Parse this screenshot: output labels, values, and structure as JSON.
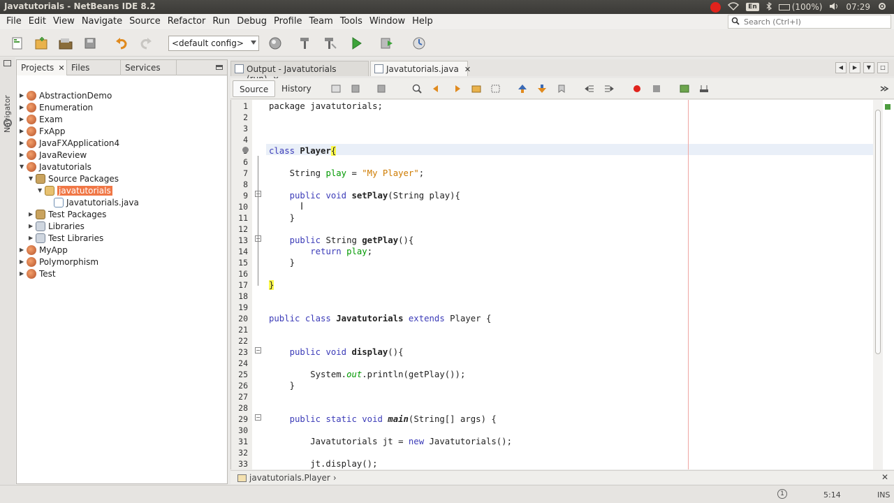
{
  "window": {
    "title": "Javatutorials - NetBeans IDE 8.2"
  },
  "tray": {
    "keyboard": "En",
    "battery": "(100%)",
    "time": "07:29"
  },
  "menu": [
    "File",
    "Edit",
    "View",
    "Navigate",
    "Source",
    "Refactor",
    "Run",
    "Debug",
    "Profile",
    "Team",
    "Tools",
    "Window",
    "Help"
  ],
  "search": {
    "placeholder": "Search (Ctrl+I)"
  },
  "toolbar": {
    "config": "<default config>"
  },
  "navigator_label": "Navigator",
  "panel_tabs": [
    "Projects",
    "Files",
    "Services"
  ],
  "tree": [
    {
      "label": "AbstractionDemo",
      "depth": 0,
      "icon": "project",
      "twisty": "▶"
    },
    {
      "label": "Enumeration",
      "depth": 0,
      "icon": "project",
      "twisty": "▶"
    },
    {
      "label": "Exam",
      "depth": 0,
      "icon": "project",
      "twisty": "▶"
    },
    {
      "label": "FxApp",
      "depth": 0,
      "icon": "project",
      "twisty": "▶"
    },
    {
      "label": "JavaFXApplication4",
      "depth": 0,
      "icon": "project",
      "twisty": "▶"
    },
    {
      "label": "JavaReview",
      "depth": 0,
      "icon": "project",
      "twisty": "▶"
    },
    {
      "label": "Javatutorials",
      "depth": 0,
      "icon": "project",
      "twisty": "▼"
    },
    {
      "label": "Source Packages",
      "depth": 1,
      "icon": "packages",
      "twisty": "▼"
    },
    {
      "label": "javatutorials",
      "depth": 2,
      "icon": "package",
      "twisty": "▼",
      "selected": true
    },
    {
      "label": "Javatutorials.java",
      "depth": 3,
      "icon": "java",
      "twisty": ""
    },
    {
      "label": "Test Packages",
      "depth": 1,
      "icon": "packages",
      "twisty": "▶"
    },
    {
      "label": "Libraries",
      "depth": 1,
      "icon": "library",
      "twisty": "▶"
    },
    {
      "label": "Test Libraries",
      "depth": 1,
      "icon": "library",
      "twisty": "▶"
    },
    {
      "label": "MyApp",
      "depth": 0,
      "icon": "project",
      "twisty": "▶"
    },
    {
      "label": "Polymorphism",
      "depth": 0,
      "icon": "project",
      "twisty": "▶"
    },
    {
      "label": "Test",
      "depth": 0,
      "icon": "project",
      "twisty": "▶"
    }
  ],
  "editor_tabs": [
    {
      "label": "Output - Javatutorials (run)",
      "active": false
    },
    {
      "label": "Javatutorials.java",
      "active": true
    }
  ],
  "editor_toolbar": {
    "source": "Source",
    "history": "History"
  },
  "code_lines": [
    [
      {
        "t": "package javatutorials;"
      }
    ],
    [],
    [],
    [],
    [
      {
        "t": "class ",
        "c": "kw"
      },
      {
        "t": "Player",
        "c": "b"
      },
      {
        "t": "{",
        "c": "hl"
      }
    ],
    [],
    [
      {
        "t": "    String "
      },
      {
        "t": "play",
        "c": "fld"
      },
      {
        "t": " = "
      },
      {
        "t": "\"My Player\"",
        "c": "str"
      },
      {
        "t": ";"
      }
    ],
    [],
    [
      {
        "t": "    "
      },
      {
        "t": "public void ",
        "c": "kw"
      },
      {
        "t": "setPlay",
        "c": "b"
      },
      {
        "t": "(String play){"
      }
    ],
    [],
    [
      {
        "t": "    }"
      }
    ],
    [],
    [
      {
        "t": "    "
      },
      {
        "t": "public ",
        "c": "kw"
      },
      {
        "t": "String "
      },
      {
        "t": "getPlay",
        "c": "b"
      },
      {
        "t": "(){"
      }
    ],
    [
      {
        "t": "        "
      },
      {
        "t": "return ",
        "c": "kw"
      },
      {
        "t": "play",
        "c": "fld"
      },
      {
        "t": ";"
      }
    ],
    [
      {
        "t": "    }"
      }
    ],
    [],
    [
      {
        "t": "}",
        "c": "hl"
      }
    ],
    [],
    [],
    [
      {
        "t": "public class ",
        "c": "kw"
      },
      {
        "t": "Javatutorials",
        "c": "b"
      },
      {
        "t": " extends ",
        "c": "kw"
      },
      {
        "t": "Player {"
      }
    ],
    [],
    [],
    [
      {
        "t": "    "
      },
      {
        "t": "public void ",
        "c": "kw"
      },
      {
        "t": "display",
        "c": "b"
      },
      {
        "t": "(){"
      }
    ],
    [],
    [
      {
        "t": "        System."
      },
      {
        "t": "out",
        "c": "fld it"
      },
      {
        "t": ".println(getPlay());"
      }
    ],
    [
      {
        "t": "    }"
      }
    ],
    [],
    [],
    [
      {
        "t": "    "
      },
      {
        "t": "public static void ",
        "c": "kw"
      },
      {
        "t": "main",
        "c": "b it"
      },
      {
        "t": "(String[] args) {"
      }
    ],
    [],
    [
      {
        "t": "        Javatutorials jt = "
      },
      {
        "t": "new ",
        "c": "kw"
      },
      {
        "t": "Javatutorials();"
      }
    ],
    [],
    [
      {
        "t": "        jt.display();"
      }
    ]
  ],
  "breadcrumb": "javatutorials.Player",
  "status": {
    "position": "5:14",
    "mode": "INS"
  }
}
